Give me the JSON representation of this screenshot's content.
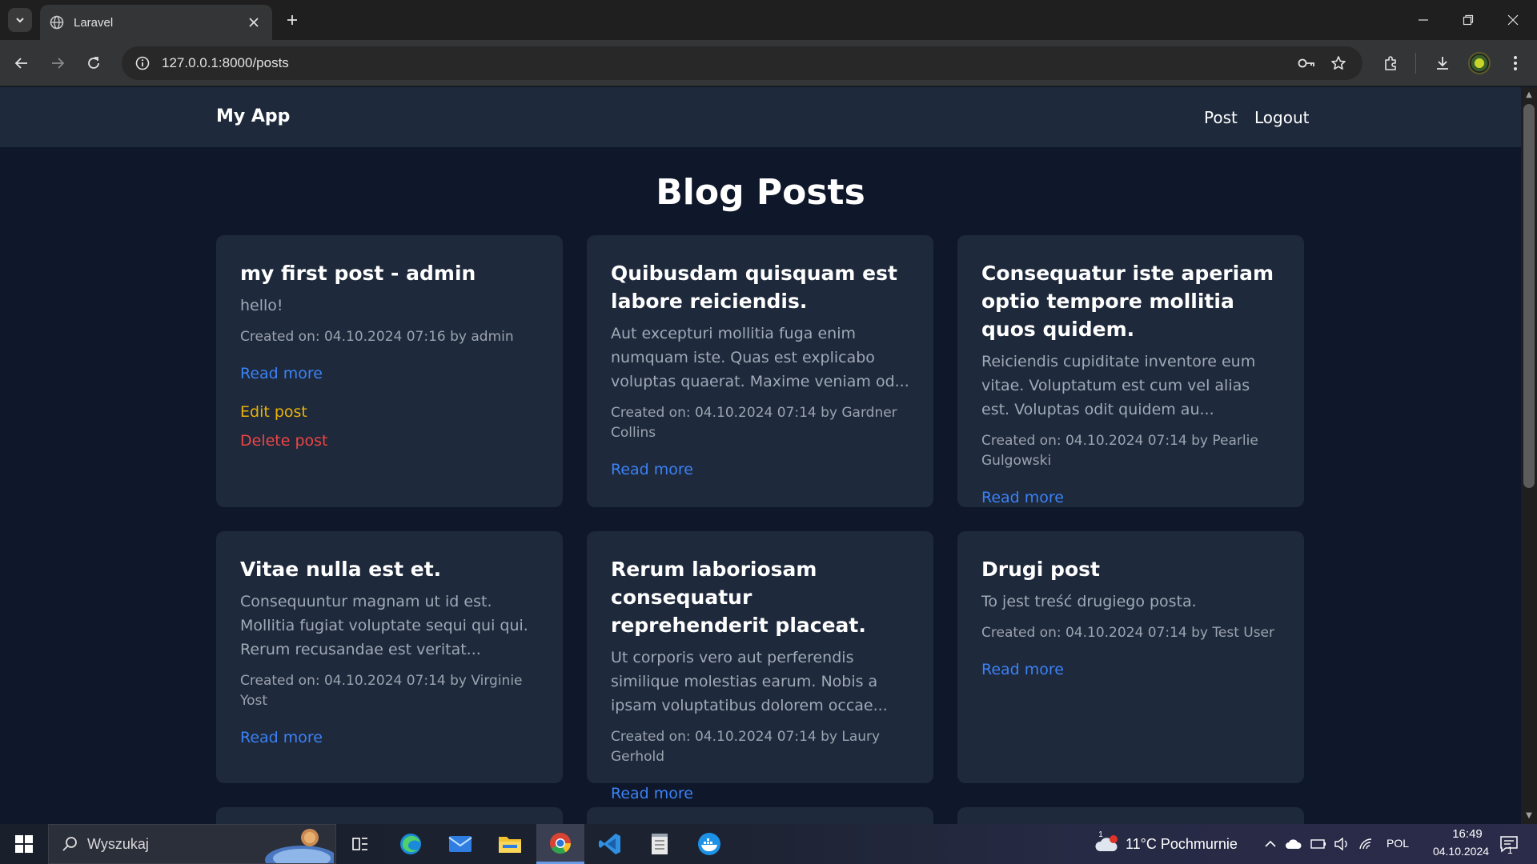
{
  "browser": {
    "tab_title": "Laravel",
    "url": "127.0.0.1:8000/posts"
  },
  "app": {
    "brand": "My App",
    "nav": [
      {
        "label": "Post"
      },
      {
        "label": "Logout"
      }
    ],
    "page_title": "Blog Posts",
    "read_more_label": "Read more",
    "edit_label": "Edit post",
    "delete_label": "Delete post"
  },
  "posts": [
    {
      "title": "my first post - admin",
      "excerpt": "hello!",
      "meta": "Created on: 04.10.2024 07:16 by admin"
    },
    {
      "title": "Quibusdam quisquam est labore reiciendis.",
      "excerpt": "Aut excepturi mollitia fuga enim numquam iste. Quas est explicabo voluptas quaerat. Maxime veniam od...",
      "meta": "Created on: 04.10.2024 07:14 by Gardner Collins"
    },
    {
      "title": "Consequatur iste aperiam optio tempore mollitia quos quidem.",
      "excerpt": "Reiciendis cupiditate inventore eum vitae. Voluptatum est cum vel alias est. Voluptas odit quidem au...",
      "meta": "Created on: 04.10.2024 07:14 by Pearlie Gulgowski"
    },
    {
      "title": "Vitae nulla est et.",
      "excerpt": "Consequuntur magnam ut id est. Mollitia fugiat voluptate sequi qui qui. Rerum recusandae est veritat...",
      "meta": "Created on: 04.10.2024 07:14 by Virginie Yost"
    },
    {
      "title": "Rerum laboriosam consequatur reprehenderit placeat.",
      "excerpt": "Ut corporis vero aut perferendis similique molestias earum. Nobis a ipsam voluptatibus dolorem occae...",
      "meta": "Created on: 04.10.2024 07:14 by Laury Gerhold"
    },
    {
      "title": "Drugi post",
      "excerpt": "To jest treść drugiego posta.",
      "meta": "Created on: 04.10.2024 07:14 by Test User"
    }
  ],
  "taskbar": {
    "search_placeholder": "Wyszukaj",
    "weather": "11°C  Pochmurnie",
    "weather_badge": "1",
    "language": "POL",
    "time": "16:49",
    "date": "04.10.2024",
    "notification_count": "1"
  }
}
